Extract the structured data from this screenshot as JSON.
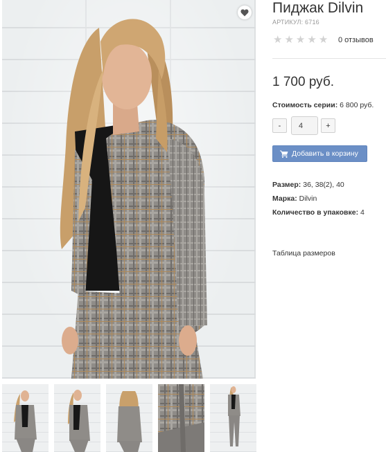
{
  "product": {
    "title": "Пиджак Dilvin",
    "sku": "АРТИКУЛ: 6716",
    "rating_stars": 5,
    "rating_filled": 0,
    "reviews": "0 отзывов",
    "price": "1 700 руб.",
    "series_label": "Стоимость серии:",
    "series_value": "6 800 руб.",
    "quantity": "4",
    "qty_minus": "-",
    "qty_plus": "+",
    "add_to_cart": "Добавить в корзину",
    "size_label": "Размер:",
    "size_value": "36, 38(2), 40",
    "brand_label": "Марка:",
    "brand_value": "Dilvin",
    "pack_label": "Количество в упаковке:",
    "pack_value": "4",
    "size_table_link": "Таблица размеров"
  },
  "gallery": {
    "main_image": "model-in-plaid-blazer",
    "wishlist_icon": "heart-icon",
    "thumbnails": [
      "front-view",
      "front-view-2",
      "back-view",
      "fabric-closeup",
      "full-length-view"
    ]
  },
  "colors": {
    "button_blue": "#6b8fc6",
    "star_gray": "#d2d2d2",
    "text": "#333333",
    "muted": "#999999"
  }
}
